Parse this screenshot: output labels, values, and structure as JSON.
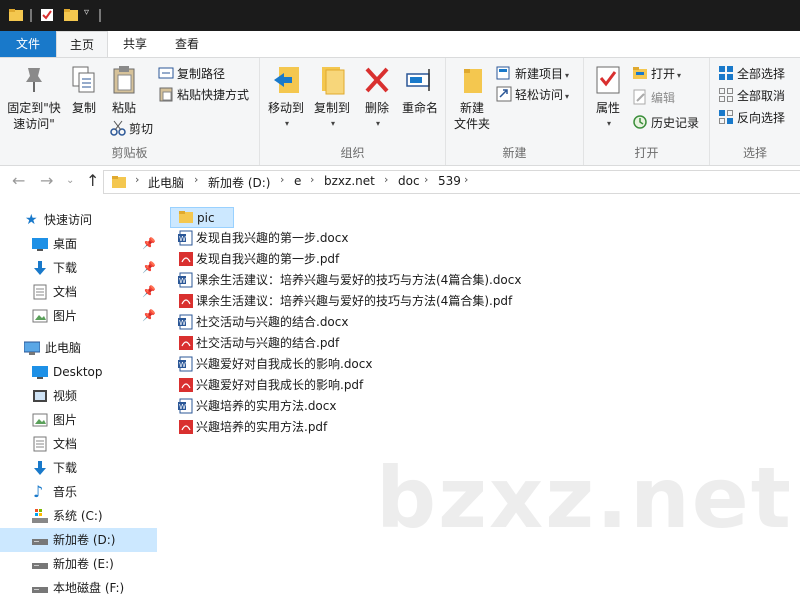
{
  "ribbon_tabs": [
    "文件",
    "主页",
    "共享",
    "查看"
  ],
  "ribbon": {
    "clipboard": {
      "pin_label_1": "固定到\"快",
      "pin_label_2": "速访问\"",
      "copy": "复制",
      "paste": "粘贴",
      "copy_path": "复制路径",
      "paste_shortcut": "粘贴快捷方式",
      "cut": "剪切",
      "group_label": "剪贴板"
    },
    "organize": {
      "move_to": "移动到",
      "copy_to": "复制到",
      "delete": "删除",
      "rename": "重命名",
      "group_label": "组织"
    },
    "new": {
      "new_folder_1": "新建",
      "new_folder_2": "文件夹",
      "new_item": "新建项目",
      "easy_access": "轻松访问",
      "group_label": "新建"
    },
    "open": {
      "properties": "属性",
      "open": "打开",
      "edit": "编辑",
      "history": "历史记录",
      "group_label": "打开"
    },
    "select": {
      "select_all": "全部选择",
      "select_none": "全部取消",
      "invert": "反向选择",
      "group_label": "选择"
    }
  },
  "breadcrumb": [
    "此电脑",
    "新加卷 (D:)",
    "e",
    "bzxz.net",
    "doc",
    "539"
  ],
  "sidebar": {
    "quick_access": "快速访问",
    "quick_items": [
      "桌面",
      "下载",
      "文档",
      "图片"
    ],
    "this_pc": "此电脑",
    "pc_items": [
      "Desktop",
      "视频",
      "图片",
      "文档",
      "下载",
      "音乐",
      "系统 (C:)",
      "新加卷 (D:)",
      "新加卷 (E:)",
      "本地磁盘 (F:)"
    ]
  },
  "files": [
    {
      "name": "pic",
      "type": "folder"
    },
    {
      "name": "发现自我兴趣的第一步.docx",
      "type": "docx"
    },
    {
      "name": "发现自我兴趣的第一步.pdf",
      "type": "pdf"
    },
    {
      "name": "课余生活建议：培养兴趣与爱好的技巧与方法(4篇合集).docx",
      "type": "docx"
    },
    {
      "name": "课余生活建议：培养兴趣与爱好的技巧与方法(4篇合集).pdf",
      "type": "pdf"
    },
    {
      "name": "社交活动与兴趣的结合.docx",
      "type": "docx"
    },
    {
      "name": "社交活动与兴趣的结合.pdf",
      "type": "pdf"
    },
    {
      "name": "兴趣爱好对自我成长的影响.docx",
      "type": "docx"
    },
    {
      "name": "兴趣爱好对自我成长的影响.pdf",
      "type": "pdf"
    },
    {
      "name": "兴趣培养的实用方法.docx",
      "type": "docx"
    },
    {
      "name": "兴趣培养的实用方法.pdf",
      "type": "pdf"
    }
  ],
  "watermark": "bzxz.net",
  "colors": {
    "accent": "#1979ca",
    "selection": "#cce8ff",
    "folder": "#f4c74f",
    "pdf": "#d9302f",
    "word": "#2b5797"
  }
}
